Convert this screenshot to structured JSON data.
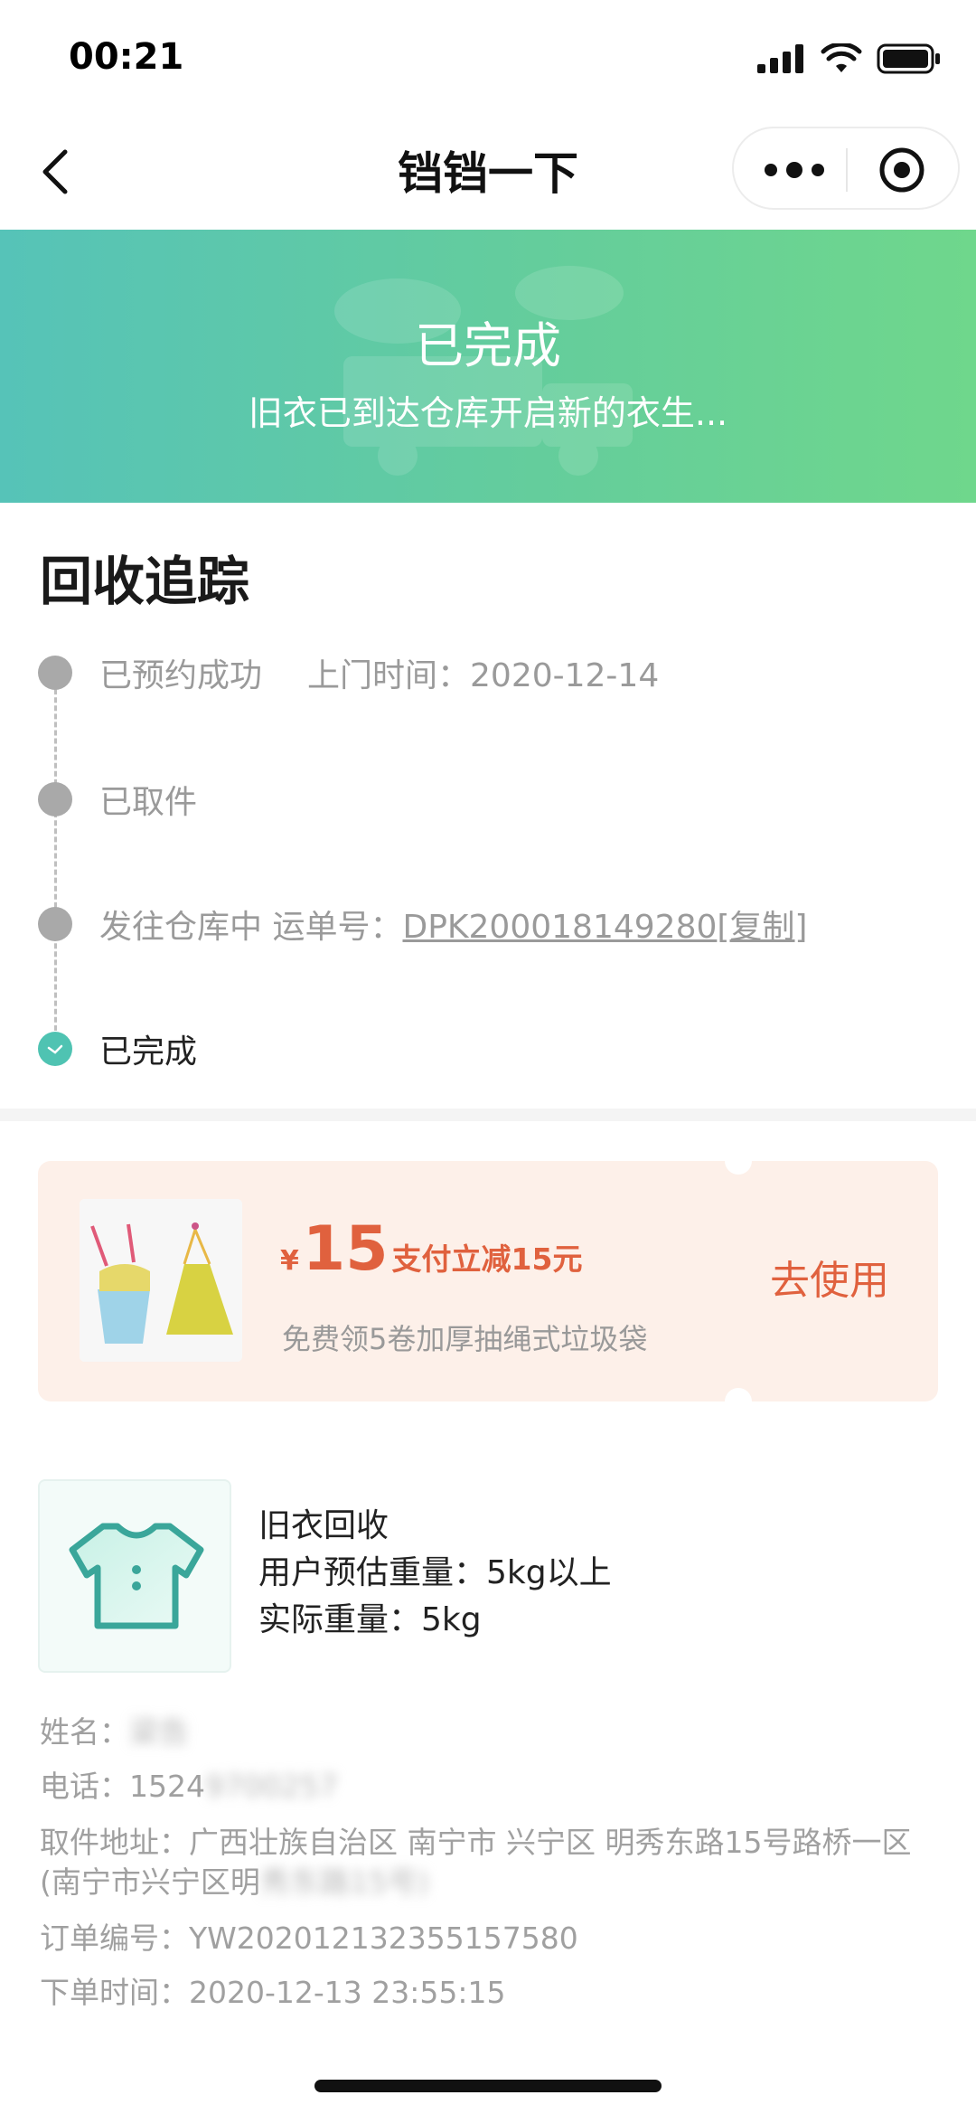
{
  "status_bar": {
    "time": "00:21"
  },
  "nav": {
    "title": "铛铛一下"
  },
  "banner": {
    "title": "已完成",
    "subtitle": "旧衣已到达仓库开启新的衣生..."
  },
  "tracking": {
    "title": "回收追踪",
    "steps": [
      {
        "label": "已预约成功",
        "extra": "上门时间：2020-12-14"
      },
      {
        "label": "已取件"
      },
      {
        "label": "发往仓库中",
        "extra_label": "运单号：",
        "waybill": "DPK200018149280",
        "copy_text": "[复制]"
      },
      {
        "label": "已完成"
      }
    ]
  },
  "coupon": {
    "currency": "¥",
    "value": "15",
    "description": "支付立减15元",
    "subtitle": "免费领5卷加厚抽绳式垃圾袋",
    "button": "去使用"
  },
  "product": {
    "name": "旧衣回收",
    "estimated_weight": "用户预估重量：5kg以上",
    "actual_weight": "实际重量：5kg"
  },
  "info": {
    "name_label": "姓名：",
    "name_value": "梁告",
    "phone_label": "电话：",
    "phone_value": "1524",
    "phone_hidden": "9700257",
    "address_label": "取件地址：",
    "address_value": "广西壮族自治区 南宁市 兴宁区 明秀东路15号路桥一区(南宁市兴宁区明",
    "address_hidden": "秀东路15号)",
    "order_label": "订单编号：",
    "order_value": "YW202012132355157580",
    "time_label": "下单时间：",
    "time_value": "2020-12-13 23:55:15"
  },
  "colors": {
    "accent": "#4fc3b2",
    "coupon_red": "#e0613e",
    "coupon_bg": "#fdf0e9"
  }
}
